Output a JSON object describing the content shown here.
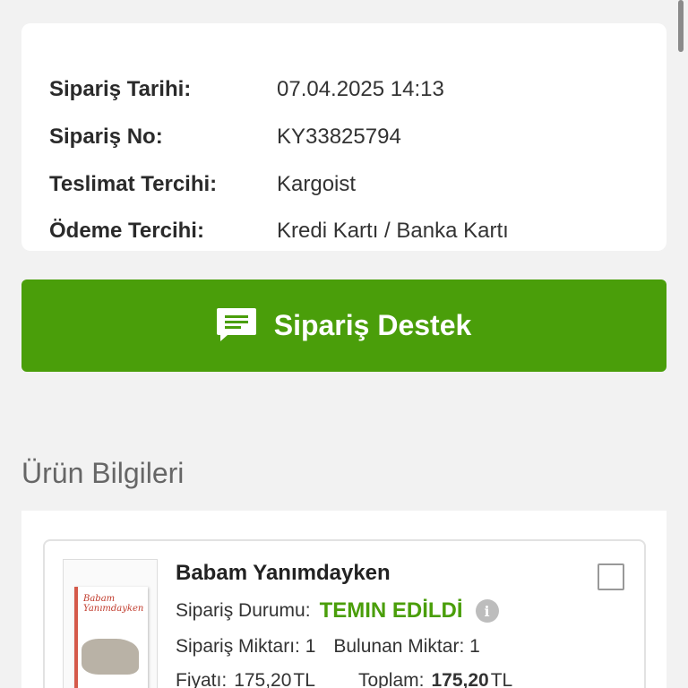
{
  "order_info": {
    "rows": [
      {
        "label": "Sipariş Tarihi:",
        "value": "07.04.2025 14:13"
      },
      {
        "label": "Sipariş No:",
        "value": "KY33825794"
      },
      {
        "label": "Teslimat Tercihi:",
        "value": "Kargoist"
      },
      {
        "label": "Ödeme Tercihi:",
        "value": "Kredi Kartı / Banka Kartı"
      }
    ]
  },
  "support_button": {
    "label": "Sipariş Destek",
    "icon": "chat-icon"
  },
  "section_title": "Ürün Bilgileri",
  "product": {
    "title": "Babam Yanımdayken",
    "cover_text": "Babam Yanımdayken",
    "status_label": "Sipariş Durumu:",
    "status_value": "TEMIN EDİLDİ",
    "status_info_icon": "info-icon",
    "ordered_qty_label": "Sipariş Miktarı: 1",
    "found_qty_label": "Bulunan Miktar: 1",
    "price_label": "Fiyatı:",
    "price_value": "175,20",
    "currency": "TL",
    "total_label": "Toplam:",
    "total_value": "175,20"
  },
  "colors": {
    "accent": "#4a9e0a",
    "background": "#f2f2f2"
  }
}
